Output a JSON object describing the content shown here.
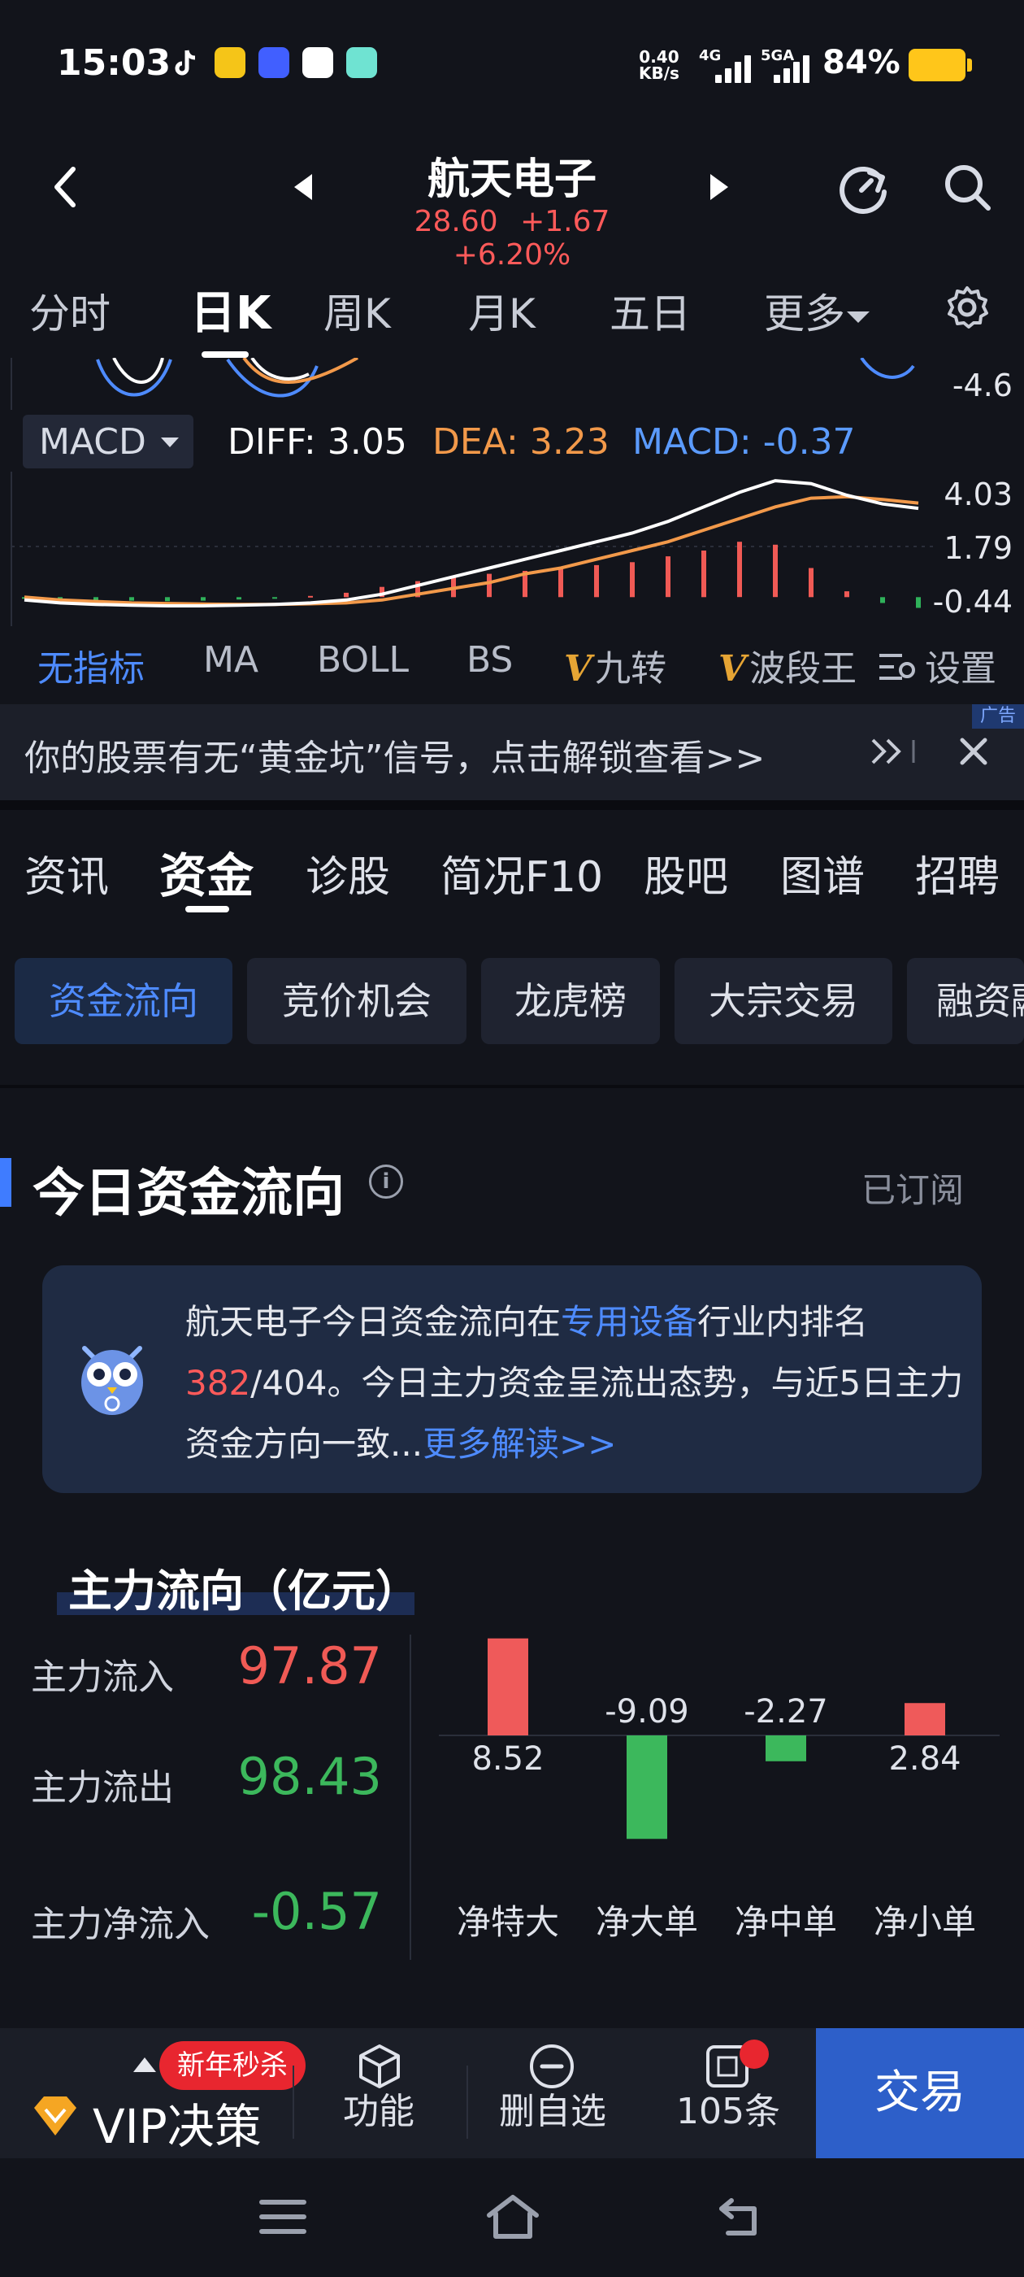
{
  "status_bar": {
    "time": "15:03",
    "net_speed_value": "0.40",
    "net_speed_unit": "KB/s",
    "sim1_label": "4G",
    "sim2_label": "5GA",
    "battery_pct": "84%",
    "app_icons": [
      "tiktok-icon",
      "yellow-app-icon",
      "vivo-icon",
      "sync-app-icon",
      "teal-app-icon"
    ],
    "battery_color": "#ffc61a"
  },
  "header": {
    "stock_name": "航天电子",
    "price": "28.60",
    "change": "+1.67",
    "change_pct": "+6.20%",
    "icons": [
      "back-icon",
      "prev-stock-icon",
      "next-stock-icon",
      "refresh-icon",
      "search-icon"
    ]
  },
  "period_tabs": [
    {
      "label": "分时"
    },
    {
      "label": "日K",
      "active": true
    },
    {
      "label": "周K"
    },
    {
      "label": "月K"
    },
    {
      "label": "五日"
    },
    {
      "label": "更多"
    }
  ],
  "upper_chart": {
    "axis_label": "-4.6"
  },
  "macd": {
    "selector": "MACD",
    "diff": "DIFF: 3.05",
    "dea": "DEA: 3.23",
    "macd": "MACD: -0.37",
    "axis": [
      "4.03",
      "1.79",
      "-0.44"
    ],
    "colors": {
      "diff": "#ffffff",
      "dea": "#f2994a",
      "macd": "#5b9bff",
      "bar_up": "#f05a55",
      "bar_down": "#2fb25a"
    }
  },
  "chart_data": {
    "type": "line",
    "title": "MACD",
    "ylim": [
      -0.44,
      4.03
    ],
    "series": [
      {
        "name": "DIFF",
        "values": [
          -0.1,
          -0.2,
          -0.25,
          -0.28,
          -0.3,
          -0.3,
          -0.28,
          -0.25,
          -0.2,
          -0.1,
          0.1,
          0.4,
          0.7,
          1.0,
          1.3,
          1.6,
          1.9,
          2.2,
          2.6,
          3.1,
          3.6,
          4.0,
          3.9,
          3.5,
          3.2,
          3.05
        ]
      },
      {
        "name": "DEA",
        "values": [
          0.0,
          -0.1,
          -0.15,
          -0.2,
          -0.22,
          -0.24,
          -0.25,
          -0.25,
          -0.23,
          -0.2,
          -0.1,
          0.1,
          0.3,
          0.5,
          0.8,
          1.0,
          1.3,
          1.6,
          1.9,
          2.3,
          2.7,
          3.1,
          3.4,
          3.45,
          3.35,
          3.23
        ]
      },
      {
        "name": "MACD",
        "values": [
          -0.05,
          -0.08,
          -0.1,
          -0.12,
          -0.14,
          -0.12,
          -0.08,
          -0.02,
          0.04,
          0.15,
          0.35,
          0.55,
          0.7,
          0.8,
          0.9,
          1.0,
          1.1,
          1.2,
          1.4,
          1.6,
          1.9,
          1.8,
          1.0,
          0.2,
          -0.2,
          -0.37
        ]
      }
    ]
  },
  "indicators": [
    {
      "label": "无指标",
      "active": true
    },
    {
      "label": "MA"
    },
    {
      "label": "BOLL"
    },
    {
      "label": "BS"
    },
    {
      "label": "九转",
      "v": "V"
    },
    {
      "label": "波段王",
      "v": "V"
    },
    {
      "label": "设置"
    }
  ],
  "ad": {
    "text": "你的股票有无“黄金坑”信号，点击解锁查看>>",
    "badge": "广告"
  },
  "section_tabs": [
    {
      "label": "资讯"
    },
    {
      "label": "资金",
      "active": true
    },
    {
      "label": "诊股"
    },
    {
      "label": "简况F10"
    },
    {
      "label": "股吧"
    },
    {
      "label": "图谱"
    },
    {
      "label": "招聘"
    }
  ],
  "sub_tabs": [
    {
      "label": "资金流向",
      "active": true
    },
    {
      "label": "竞价机会"
    },
    {
      "label": "龙虎榜"
    },
    {
      "label": "大宗交易"
    },
    {
      "label": "融资融"
    }
  ],
  "fund_flow": {
    "title": "今日资金流向",
    "info": "i",
    "subscribed": "已订阅",
    "analysis": {
      "p1": "航天电子今日资金流向在",
      "industry": "专用设备",
      "p2": "行业内排名",
      "rank": "382",
      "p3": "/404。今日主力资金呈流出态势，与近5日主力资金方向一致...",
      "more": "更多解读>>"
    }
  },
  "main_flow": {
    "title": "主力流向（亿元）",
    "rows": [
      {
        "label": "主力流入",
        "value": "97.87",
        "color": "#f05a55"
      },
      {
        "label": "主力流出",
        "value": "98.43",
        "color": "#3cb85c"
      },
      {
        "label": "主力净流入",
        "value": "-0.57",
        "color": "#3cb85c"
      }
    ],
    "bars": [
      {
        "category": "净特大",
        "value": 8.52,
        "label": "8.52"
      },
      {
        "category": "净大单",
        "value": -9.09,
        "label": "-9.09"
      },
      {
        "category": "净中单",
        "value": -2.27,
        "label": "-2.27"
      },
      {
        "category": "净小单",
        "value": 2.84,
        "label": "2.84"
      }
    ]
  },
  "bottom_bar": {
    "promo": "新年秒杀",
    "vip": "VIP决策",
    "function": "功能",
    "remove_fav": "删自选",
    "questions": "105条",
    "trade": "交易"
  }
}
